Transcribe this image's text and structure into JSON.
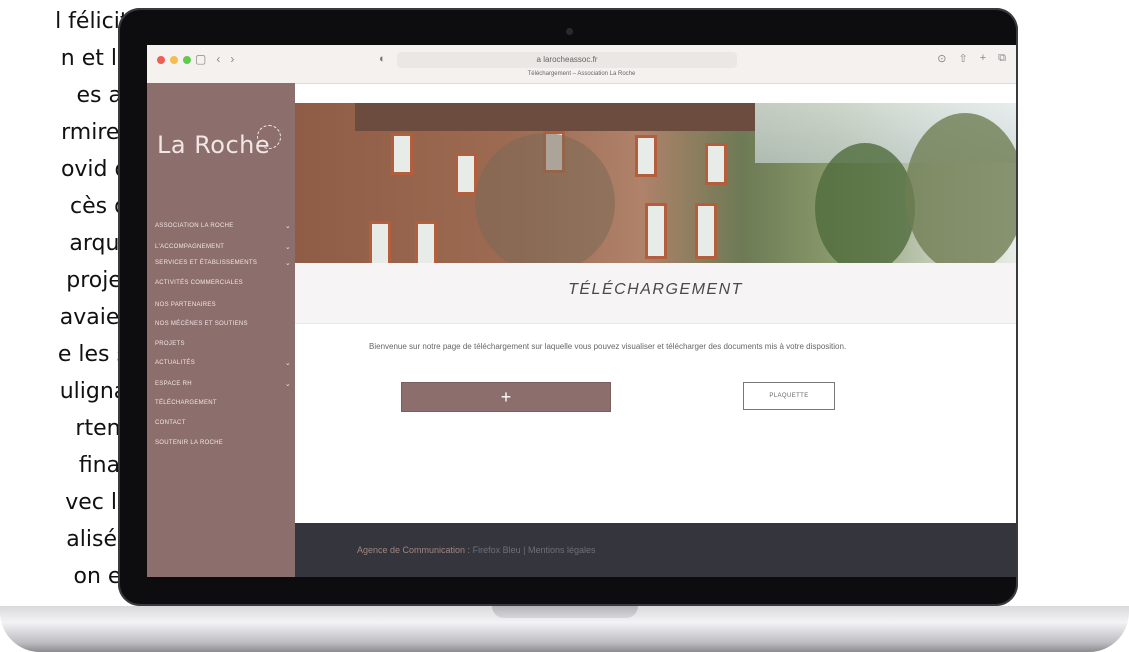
{
  "article_lines": [
    "l félicita",
    "n et les",
    "es   ac-",
    "rmirent",
    "ovid de",
    "cès  dû",
    "arquer",
    "projets",
    "avaient",
    "e les si-",
    "ulignait",
    "rtena-",
    "finan-",
    "vec les",
    "alisées",
    "on  ex-"
  ],
  "browser": {
    "url": "a larocheassoc.fr",
    "tab_title": "Téléchargement – Association La Roche"
  },
  "sidebar": {
    "logo": "La Roche",
    "items": [
      {
        "label": "Association La Roche",
        "chevron": true
      },
      {
        "label": "L'accompagnement",
        "chevron": true
      },
      {
        "label": "Services et établissements",
        "chevron": true
      },
      {
        "label": "Activités commerciales",
        "chevron": false
      },
      {
        "label": "Nos partenaires",
        "chevron": false
      },
      {
        "label": "Nos mécènes et soutiens",
        "chevron": false
      },
      {
        "label": "Projets",
        "chevron": false
      },
      {
        "label": "Actualités",
        "chevron": true
      },
      {
        "label": "Espace RH",
        "chevron": true
      },
      {
        "label": "Téléchargement",
        "chevron": false
      },
      {
        "label": "Contact",
        "chevron": false
      },
      {
        "label": "Soutenir La Roche",
        "chevron": false
      }
    ]
  },
  "main": {
    "title": "TÉLÉCHARGEMENT",
    "intro": "Bienvenue sur notre page de téléchargement sur laquelle vous pouvez visualiser et télécharger des documents mis à votre disposition.",
    "plus_label": "+",
    "plaquette_label": "PLAQUETTE"
  },
  "footer": {
    "prefix": "Agence de Communication : ",
    "link1": "Firefox Bleu",
    "separator": " | ",
    "link2": "Mentions légales"
  },
  "colors": {
    "sidebar": "#8c6f6d",
    "footer": "#34353d",
    "button": "#8c6f6d"
  }
}
